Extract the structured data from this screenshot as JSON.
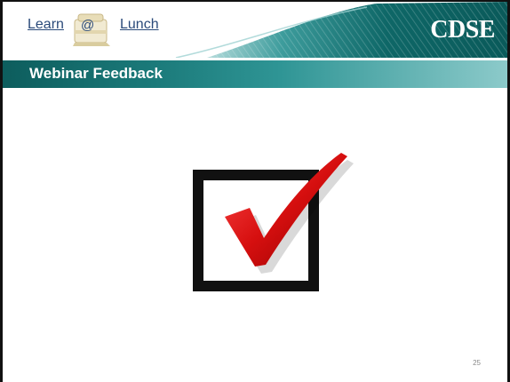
{
  "logo": {
    "learn": "Learn",
    "at": "@",
    "lunch": "Lunch"
  },
  "brand": {
    "name": "CDSE"
  },
  "slide": {
    "title": "Webinar Feedback",
    "page_number": "25"
  },
  "icons": {
    "main": "checkbox-checked-icon"
  },
  "colors": {
    "title_bar": "#1b7a7a",
    "header_band": "#0e6767",
    "check_red": "#d60f0f",
    "logo_text": "#2a4a7a"
  }
}
